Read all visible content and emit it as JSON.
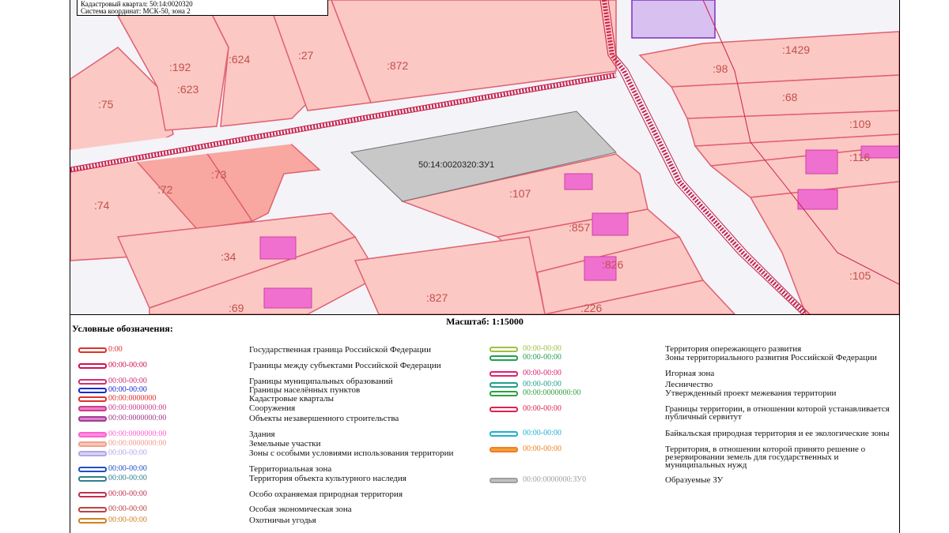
{
  "info": {
    "quarter": "Кадастровый квартал: 50:14:0020320",
    "coords": "Система координат: МСК-50, зона 2"
  },
  "map": {
    "labels": {
      "p192": ":192",
      "p624": ":624",
      "p27": ":27",
      "p872": ":872",
      "p623": ":623",
      "p75": ":75",
      "p1429": ":1429",
      "p98": ":98",
      "p68": ":68",
      "p109": ":109",
      "p116": ":116",
      "p73": ":73",
      "p72": ":72",
      "p74": ":74",
      "p107": ":107",
      "p857": ":857",
      "p826": ":826",
      "p34": ":34",
      "p105": ":105",
      "p69": ":69",
      "p827": ":827",
      "p226": ":226"
    },
    "zu_label": "50:14:0020320:ЗУ1"
  },
  "scale": "Масштаб: 1:15000",
  "legend": {
    "title": "Условные обозначения:",
    "items": [
      {
        "code": "0:00",
        "desc": "Государственная граница Российской Федерации",
        "color": "#e0302a",
        "fill": "#ffffff"
      },
      {
        "code": "00:00-00:00",
        "desc": "Границы между субъектами Российской Федерации",
        "color": "#d01050",
        "fill": "#ffffff"
      },
      {
        "code": "00:00-00:00",
        "desc": "Границы муниципальных образований",
        "color": "#d03070",
        "fill": "#ffffff"
      },
      {
        "code": "00:00-00:00",
        "desc": "Границы населённых пунктов",
        "color": "#1a2ad0",
        "fill": "#ffffff"
      },
      {
        "code": "00:00:0000000",
        "desc": "Кадастровые кварталы",
        "color": "#e03030",
        "fill": "#ffffff"
      },
      {
        "code": "00:00:0000000:00",
        "desc": "Сооружения",
        "color": "#c84090",
        "fill": "#f07ec8"
      },
      {
        "code": "00:00:0000000:00",
        "desc": "Объекты незавершенного строительства",
        "color": "#a04090",
        "fill": "#e080d0"
      },
      {
        "code": "00:00:0000000:00",
        "desc": "Здания",
        "color": "#ff60d0",
        "fill": "#ff90e0"
      },
      {
        "code": "00:00:0000000:00",
        "desc": "Земельные участки",
        "color": "#f0a090",
        "fill": "#fcc8b8"
      },
      {
        "code": "00:00-00:00",
        "desc": "Зоны с особыми условиями использования территории",
        "color": "#b0a8e8",
        "fill": "#d8d4f8"
      },
      {
        "code": "00:00-00:00",
        "desc": "Территориальная зона",
        "color": "#2050c0",
        "fill": "#ffffff"
      },
      {
        "code": "00:00-00:00",
        "desc": "Территория объекта культурного наследия",
        "color": "#308090",
        "fill": "#ffffff"
      },
      {
        "code": "00:00-00:00",
        "desc": "Особо охраняемая природная территория",
        "color": "#c03050",
        "fill": "#ffffff"
      },
      {
        "code": "00:00-00:00",
        "desc": "Особая экономическая зона",
        "color": "#c04040",
        "fill": "#ffffff"
      },
      {
        "code": "00:00-00:00",
        "desc": "Охотничьи угодья",
        "color": "#d08020",
        "fill": "#ffffff"
      }
    ],
    "items2": [
      {
        "code": "00:00-00:00",
        "desc": "Территория опережающего развития",
        "color": "#a0c040",
        "fill": "#ffffff"
      },
      {
        "code": "00:00-00:00",
        "desc": "Зоны территориального развития Российской Федерации",
        "color": "#20a050",
        "fill": "#ffffff"
      },
      {
        "code": "00:00-00:00",
        "desc": "Игорная зона",
        "color": "#e02070",
        "fill": "#ffffff"
      },
      {
        "code": "00:00-00:00",
        "desc": "Лесничество",
        "color": "#20a090",
        "fill": "#ffffff"
      },
      {
        "code": "00:00:0000000:00",
        "desc": "Утвержденный проект межевания территории",
        "color": "#30a040",
        "fill": "#ffffff"
      },
      {
        "code": "00:00-00:00",
        "desc": "Границы территории, в отношении которой устанавливается публичный сервитут",
        "color": "#e02050",
        "fill": "#ffffff"
      },
      {
        "code": "00:00-00:00",
        "desc": "Байкальская природная территория и ее экологические зоны",
        "color": "#20b0d0",
        "fill": "#ffffff"
      },
      {
        "code": "00:00-00:00",
        "desc": "Территория, в отношении которой принято решение о резервировании земель для государственных и муниципальных нужд",
        "color": "#f08020",
        "fill": "#f0a040"
      },
      {
        "code": "00:00:0000000:ЗУ0",
        "desc": "Образуемые ЗУ",
        "color": "#a0a0a0",
        "fill": "#c0c0c0"
      }
    ]
  }
}
